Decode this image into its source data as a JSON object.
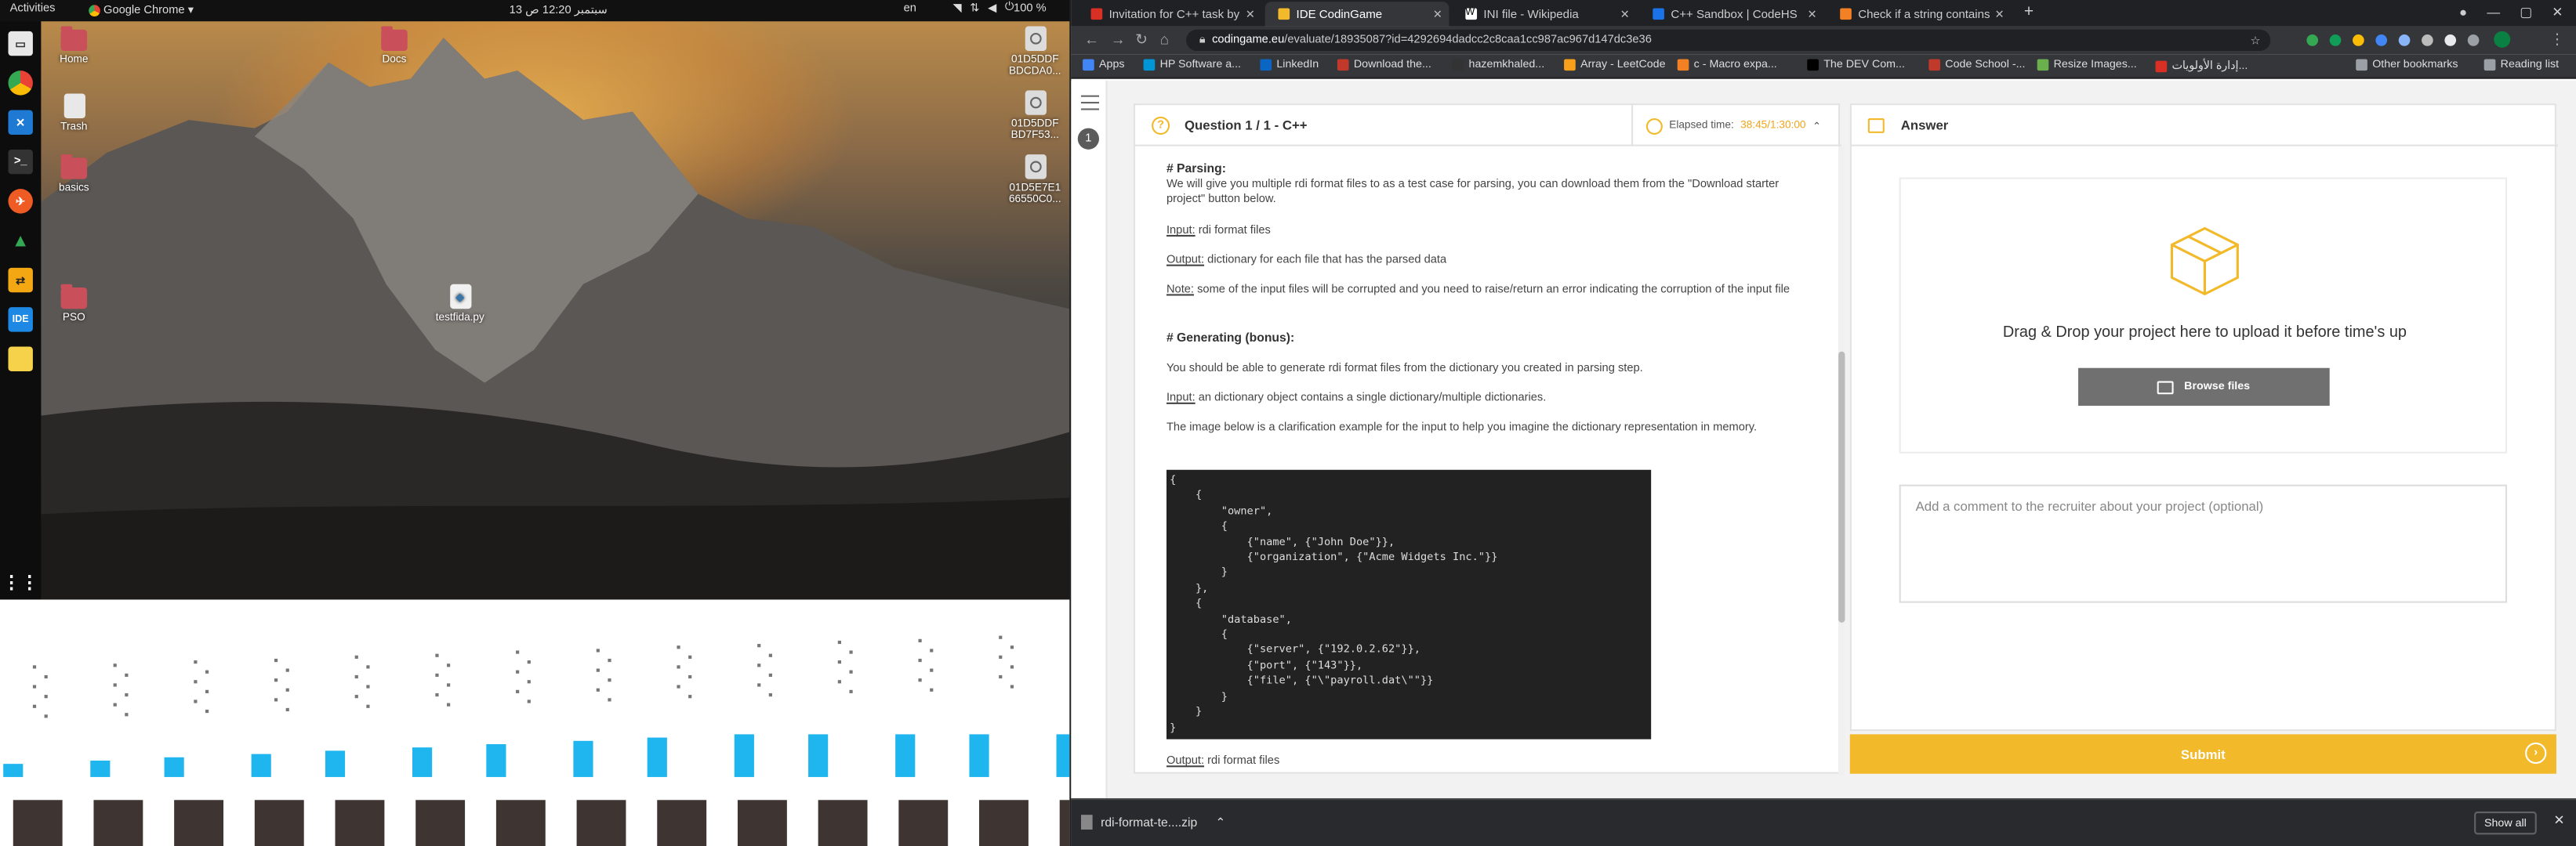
{
  "gnome": {
    "activities": "Activities",
    "app_name": "Google Chrome",
    "clock": "13 سبتمبر  12:20 ص",
    "lang": "en",
    "battery": "100 %"
  },
  "desktop": {
    "icons": [
      {
        "label": "Home",
        "kind": "folder"
      },
      {
        "label": "Trash",
        "kind": "trash"
      },
      {
        "label": "basics",
        "kind": "folder"
      },
      {
        "label": "PSO",
        "kind": "folder"
      },
      {
        "label": "Docs",
        "kind": "folder"
      },
      {
        "label": "testfida.py",
        "kind": "file"
      },
      {
        "label": "01D5DDF BDCDA0...",
        "kind": "disk"
      },
      {
        "label": "01D5DDF BD7F53...",
        "kind": "disk"
      },
      {
        "label": "01D5E7E1 66550C0...",
        "kind": "disk"
      }
    ]
  },
  "chrome": {
    "tabs": [
      {
        "label": "Invitation for C++ task by",
        "color": "#d93025"
      },
      {
        "label": "IDE CodinGame",
        "color": "#f2b92a"
      },
      {
        "label": "INI file - Wikipedia",
        "color": "#ffffff"
      },
      {
        "label": "C++ Sandbox | CodeHS",
        "color": "#1a73e8"
      },
      {
        "label": "Check if a string contains",
        "color": "#f48024"
      }
    ],
    "url_host": "codingame.eu",
    "url_path": "/evaluate/18935087?id=4292694dadcc2c8caa1cc987ac967d147dc3e36",
    "bookmarks": [
      {
        "label": "Apps",
        "color": "#4285f4"
      },
      {
        "label": "HP Software a...",
        "color": "#0096d6"
      },
      {
        "label": "LinkedIn",
        "color": "#0a66c2"
      },
      {
        "label": "Download the...",
        "color": "#c0392b"
      },
      {
        "label": "hazemkhaled...",
        "color": "#333333"
      },
      {
        "label": "Array - LeetCode",
        "color": "#f89f1b"
      },
      {
        "label": "c - Macro expa...",
        "color": "#f48024"
      },
      {
        "label": "The DEV Com...",
        "color": "#000000"
      },
      {
        "label": "Code School -...",
        "color": "#c0392b"
      },
      {
        "label": "Resize Images...",
        "color": "#6ab04c"
      },
      {
        "label": "إدارة الأولويات...",
        "color": "#d93025"
      }
    ],
    "other_bookmarks": "Other bookmarks",
    "reading_list": "Reading list"
  },
  "page": {
    "question_number": "1",
    "question_title": "Question 1 / 1 - C++",
    "elapsed_label": "Elapsed time:",
    "elapsed_value": "38:45/1:30:00",
    "body": {
      "parsing_heading": "# Parsing:",
      "parsing_text": "We will give you multiple rdi format files to as a test case for parsing, you can download them from the \"Download starter project\" button below.",
      "input_label": "Input:",
      "input_text": " rdi format files",
      "output_label": "Output:",
      "output_text": " dictionary for each file that has the parsed data",
      "note_label": "Note:",
      "note_text": " some of the input files will be corrupted and you need to raise/return an error indicating the corruption of the input file",
      "generating_heading": "# Generating (bonus):",
      "generating_text": "You should be able to generate rdi format files from the dictionary you created in parsing step.",
      "input2_label": "Input:",
      "input2_text": " an dictionary object contains a single dictionary/multiple dictionaries.",
      "image_text": "The image below is a clarification example for the input to help you imagine the dictionary representation in memory.",
      "code": "{\n    {\n        \"owner\",\n        {\n            {\"name\", {\"John Doe\"}},\n            {\"organization\", {\"Acme Widgets Inc.\"}}\n        }\n    },\n    {\n        \"database\",\n        {\n            {\"server\", {\"192.0.2.62\"}},\n            {\"port\", {\"143\"}},\n            {\"file\", {\"\\\"payroll.dat\\\"\"}}\n        }\n    }\n}",
      "output2_label": "Output:",
      "output2_text": " rdi format files"
    },
    "answer_title": "Answer",
    "drop_text": "Drag & Drop your project here to upload it before time's up",
    "browse_label": "Browse files",
    "comment_placeholder": "Add a comment to the recruiter about your project (optional)",
    "submit_label": "Submit"
  },
  "downloads": {
    "file": "rdi-format-te....zip",
    "show_all": "Show all"
  },
  "colors": {
    "accent": "#f2b92a",
    "browse_bg": "#707070",
    "folder": "#c94f5a"
  }
}
